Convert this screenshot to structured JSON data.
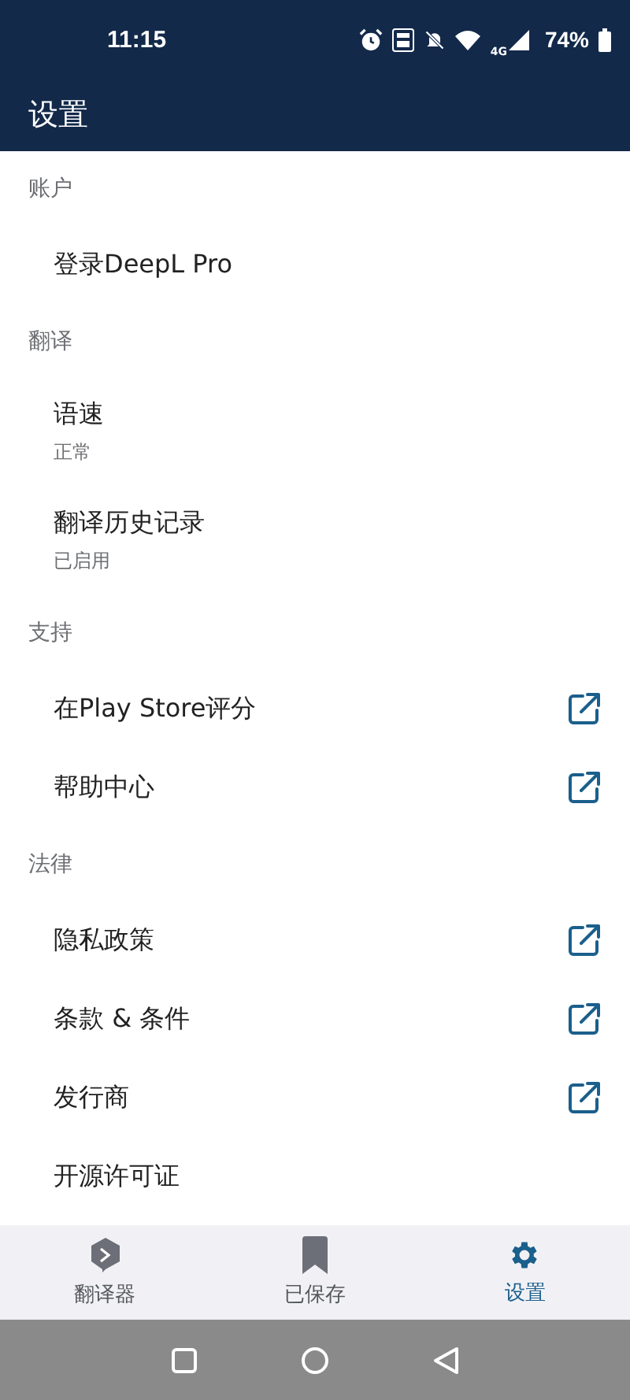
{
  "status_bar": {
    "time": "11:15",
    "battery": "74%",
    "network": "4G"
  },
  "app_bar": {
    "title": "设置"
  },
  "sections": [
    {
      "title": "账户",
      "items": [
        {
          "label": "登录DeepL Pro",
          "external": false
        }
      ]
    },
    {
      "title": "翻译",
      "items": [
        {
          "label": "语速",
          "subtitle": "正常",
          "external": false
        },
        {
          "label": "翻译历史记录",
          "subtitle": "已启用",
          "external": false
        }
      ]
    },
    {
      "title": "支持",
      "items": [
        {
          "label": "在Play Store评分",
          "external": true
        },
        {
          "label": "帮助中心",
          "external": true
        }
      ]
    },
    {
      "title": "法律",
      "items": [
        {
          "label": "隐私政策",
          "external": true
        },
        {
          "label": "条款 & 条件",
          "external": true
        },
        {
          "label": "发行商",
          "external": true
        },
        {
          "label": "开源许可证",
          "external": false
        }
      ]
    }
  ],
  "bottom_nav": [
    {
      "kind": "translator",
      "label": "翻译器",
      "selected": false
    },
    {
      "kind": "saved",
      "label": "已保存",
      "selected": false
    },
    {
      "kind": "settings",
      "label": "设置",
      "selected": true
    }
  ]
}
